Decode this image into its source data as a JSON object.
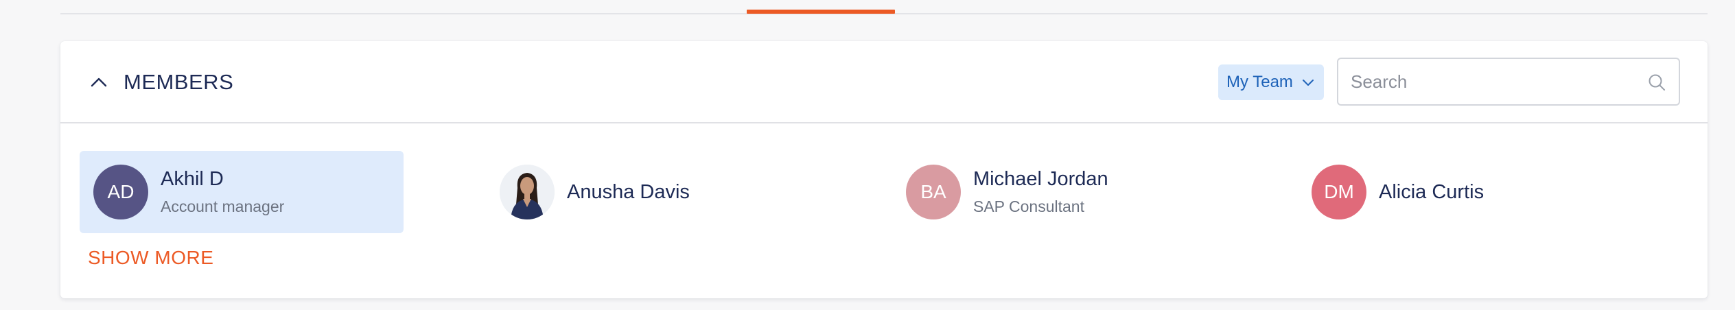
{
  "section": {
    "title": "MEMBERS"
  },
  "filter": {
    "team_label": "My Team"
  },
  "search": {
    "placeholder": "Search"
  },
  "members": [
    {
      "initials": "AD",
      "name": "Akhil D",
      "role": "Account manager",
      "avatar_color": "#565485",
      "selected": true
    },
    {
      "initials": "",
      "name": "Anusha Davis",
      "role": "",
      "avatar_color": "#e9edf3",
      "photo": true
    },
    {
      "initials": "BA",
      "name": "Michael Jordan",
      "role": "SAP Consultant",
      "avatar_color": "#d99ba1"
    },
    {
      "initials": "DM",
      "name": "Alicia Curtis",
      "role": "",
      "avatar_color": "#e06a7a"
    }
  ],
  "actions": {
    "show_more_label": "SHOW MORE"
  },
  "colors": {
    "accent": "#ec5a25",
    "primary_text": "#1d2a55",
    "selected_bg": "#dfebfc",
    "link_blue": "#1d62b8"
  }
}
